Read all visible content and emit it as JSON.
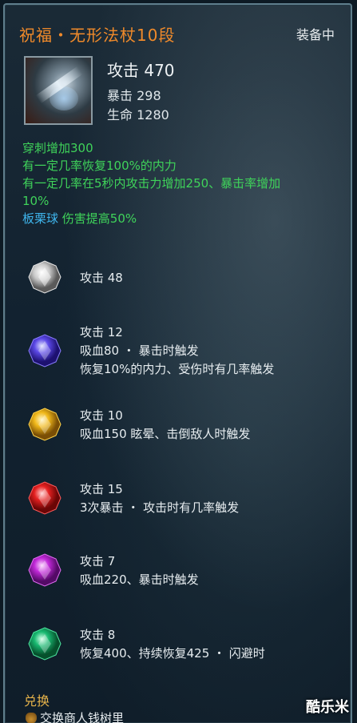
{
  "tooltip": {
    "title": "祝福・无形法杖10段",
    "status": "装备中",
    "main_stat": "攻击 470",
    "stats": [
      "暴击 298",
      "生命 1280"
    ],
    "effects": [
      "穿刺增加300",
      "有一定几率恢复100%的内力",
      "有一定几率在5秒内攻击力增加250、暴击率增加",
      "10%"
    ],
    "set_bonus": {
      "name": "板栗球",
      "text": "伤害提高50%"
    },
    "gems": [
      {
        "color": "white",
        "lines": [
          "攻击 48"
        ]
      },
      {
        "color": "blue",
        "lines": [
          "攻击 12",
          "吸血80 ・ 暴击时触发",
          "恢复10%的内力、受伤时有几率触发"
        ]
      },
      {
        "color": "yellow",
        "lines": [
          "攻击 10",
          "吸血150  眩晕、击倒敌人时触发"
        ]
      },
      {
        "color": "red",
        "lines": [
          "攻击 15",
          "3次暴击 ・ 攻击时有几率触发"
        ]
      },
      {
        "color": "purple",
        "lines": [
          "攻击 7",
          "吸血220、暴击时触发"
        ]
      },
      {
        "color": "green",
        "lines": [
          "攻击 8",
          "恢复400、持续恢复425 ・ 闪避时"
        ]
      }
    ],
    "exchange": {
      "title": "兑换",
      "item": "交换商人钱树里"
    }
  },
  "colors": {
    "title": "#f08a2a",
    "effect_green": "#3fd35a",
    "set_blue": "#3fb6ee",
    "exchange_gold": "#e5b24a"
  },
  "watermark": "酷乐米"
}
